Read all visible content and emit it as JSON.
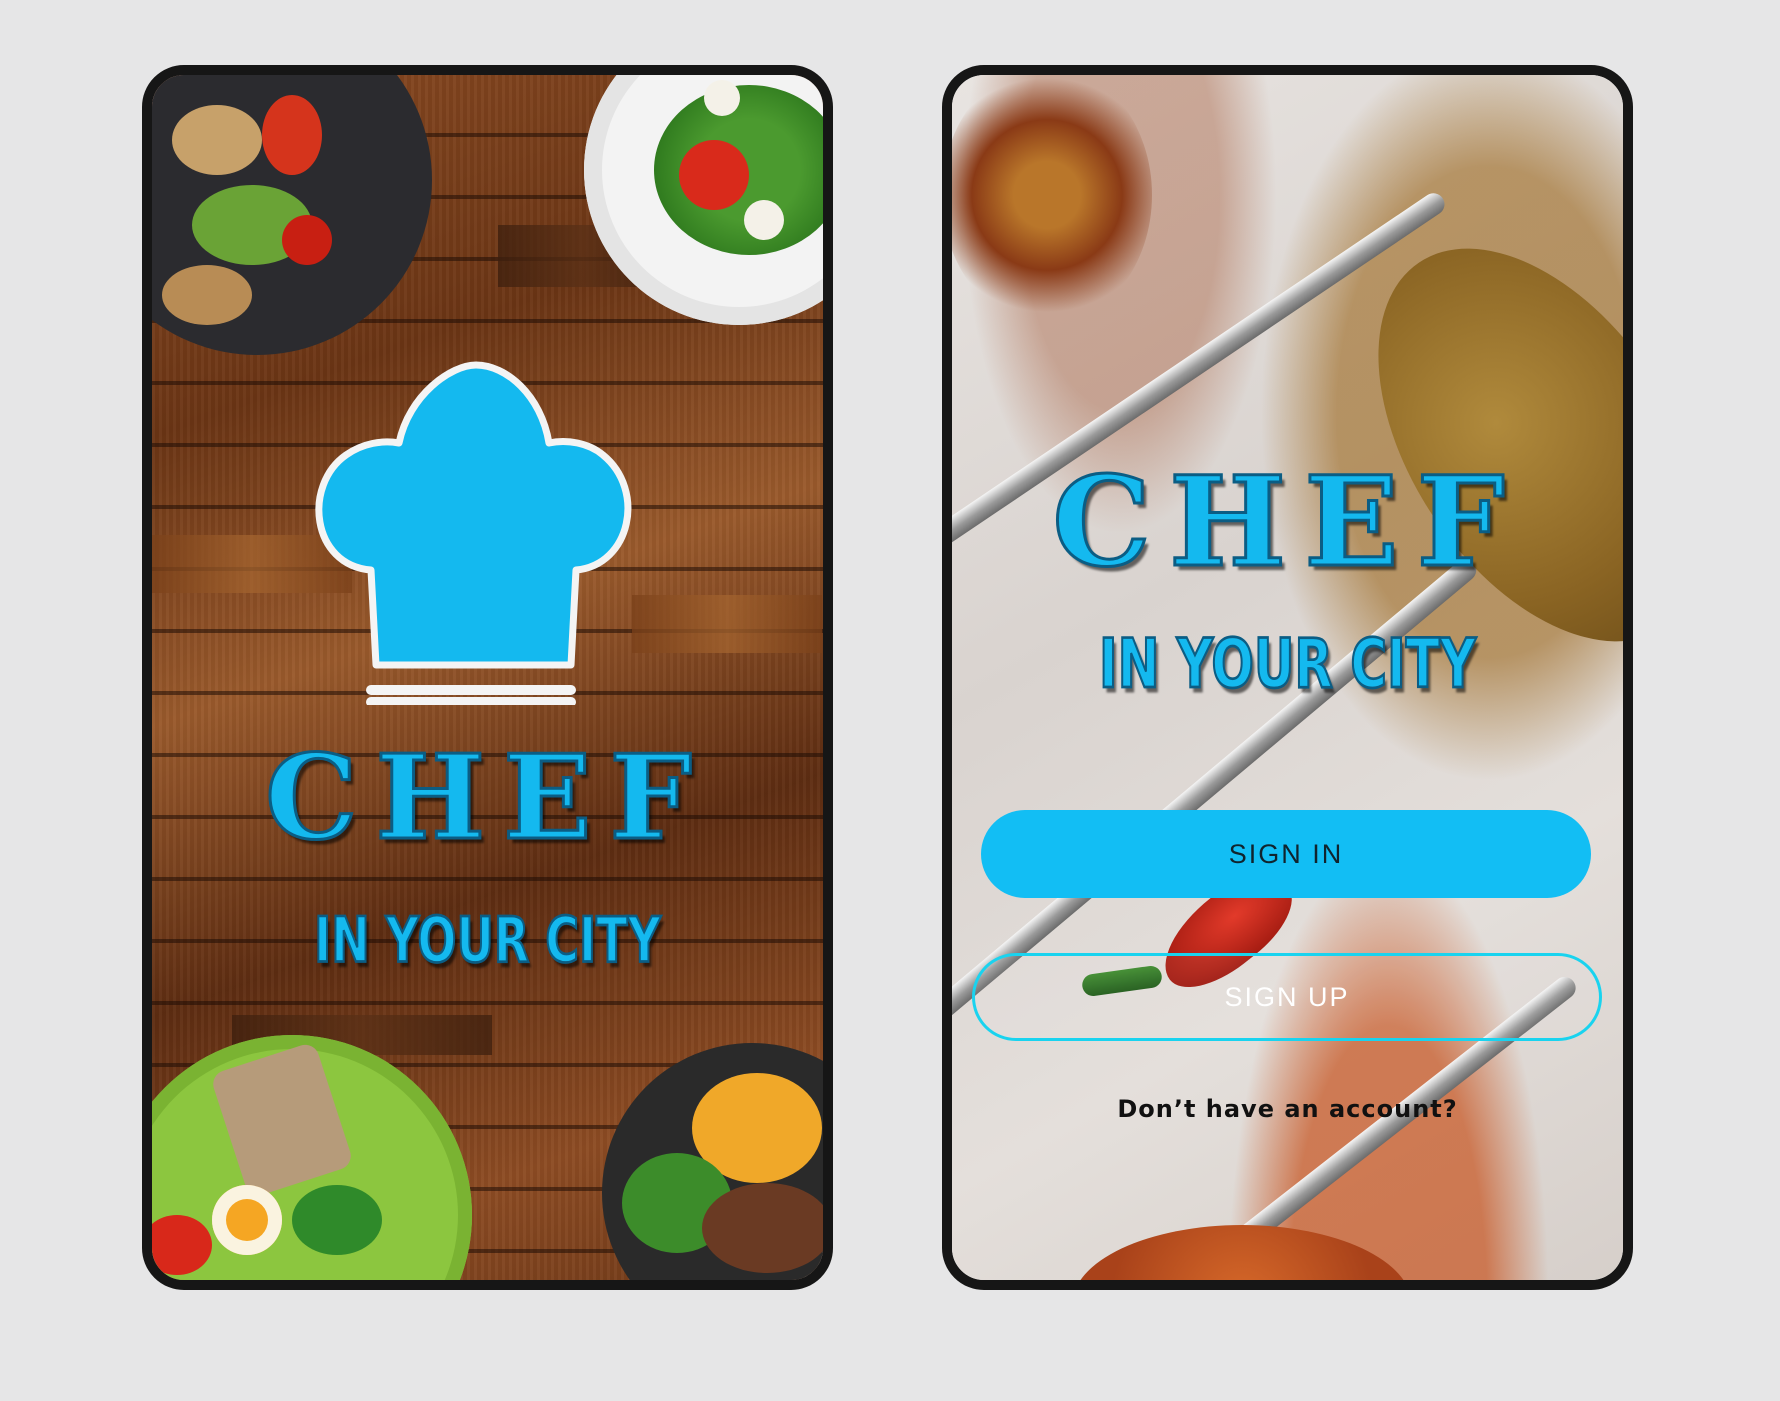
{
  "left_screen": {
    "logo": {
      "title": "CHEF",
      "subtitle": "IN YOUR CITY"
    },
    "icon": "chef-hat-icon"
  },
  "right_screen": {
    "logo": {
      "title": "CHEF",
      "subtitle": "IN YOUR CITY"
    },
    "sign_in_label": "SIGN IN",
    "sign_up_label": "SIGN UP",
    "account_prompt": "Don’t have an account?"
  },
  "colors": {
    "accent": "#12bef4",
    "outline": "#19d3ef",
    "background": "#e6e6e7",
    "frame": "#161616"
  }
}
